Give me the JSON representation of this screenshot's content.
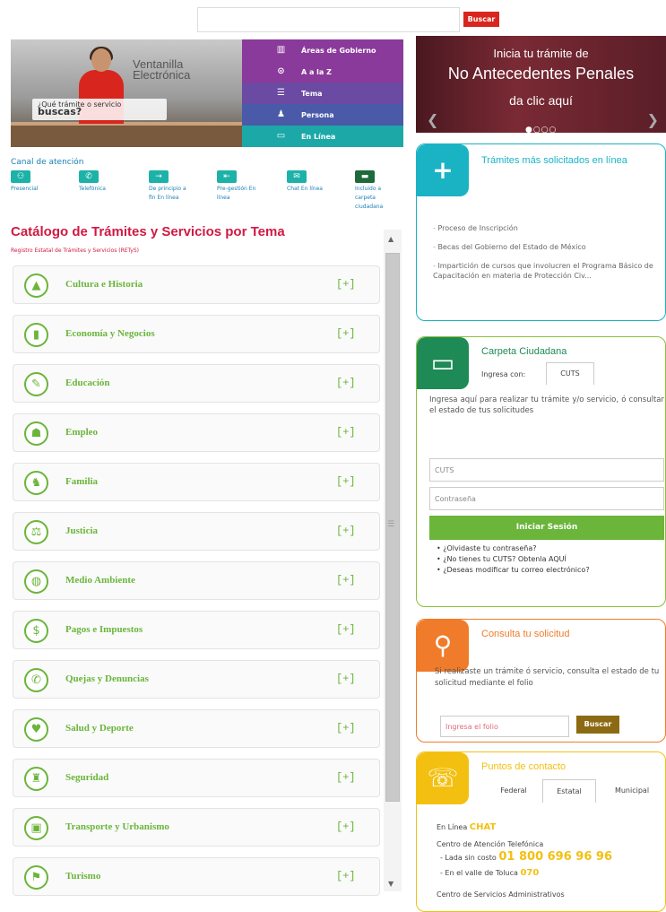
{
  "search": {
    "button": "Buscar",
    "placeholder": ""
  },
  "banner": {
    "brand_line1": "Ventanilla",
    "brand_line2": "Electrónica",
    "question_small": "¿Qué trámite o servicio",
    "question_big": "buscas?",
    "menu": [
      "Áreas de Gobierno",
      "A a la Z",
      "Tema",
      "Persona",
      "En Línea"
    ]
  },
  "canal": {
    "title": "Canal de atención",
    "items": [
      "Presencial",
      "Telefónica",
      "De principio a fin En línea",
      "Pre-gestión En línea",
      "Chat En línea",
      "Incluido a carpeta ciudadana"
    ]
  },
  "catalogo": {
    "title": "Catálogo de Trámites y Servicios por Tema",
    "subtitle": "Registro Estatal de Trámites y Servicios (RETyS)",
    "plus": "[+]",
    "items": [
      {
        "label": "Cultura e Historia",
        "icon": "pyramid-icon"
      },
      {
        "label": "Economía y Negocios",
        "icon": "chart-icon"
      },
      {
        "label": "Educación",
        "icon": "book-icon"
      },
      {
        "label": "Empleo",
        "icon": "worker-icon"
      },
      {
        "label": "Familia",
        "icon": "family-icon"
      },
      {
        "label": "Justicia",
        "icon": "scales-icon"
      },
      {
        "label": "Medio Ambiente",
        "icon": "globe-icon"
      },
      {
        "label": "Pagos e Impuestos",
        "icon": "money-icon"
      },
      {
        "label": "Quejas y Denuncias",
        "icon": "phone-icon"
      },
      {
        "label": "Salud y Deporte",
        "icon": "heart-icon"
      },
      {
        "label": "Seguridad",
        "icon": "police-icon"
      },
      {
        "label": "Transporte y Urbanismo",
        "icon": "bus-icon"
      },
      {
        "label": "Turismo",
        "icon": "signpost-icon"
      }
    ]
  },
  "carousel": {
    "line1": "Inicia tu trámite de",
    "line2": "No Antecedentes Penales",
    "line3": "da clic aquí"
  },
  "tramites": {
    "title": "Trámites más solicitados en línea",
    "items": [
      "Proceso de Inscripción",
      "Becas del Gobierno del Estado de México",
      "Impartición de cursos que involucren el Programa Básico de Capacitación en materia de Protección Civ..."
    ]
  },
  "carpeta": {
    "title": "Carpeta Ciudadana",
    "ingresa": "Ingresa con:",
    "tab": "CUTS",
    "desc": "Ingresa aquí para realizar tu trámite y/o servicio, ó consultar el estado de tus solicitudes",
    "cuts_placeholder": "CUTS",
    "pass_placeholder": "Contraseña",
    "login": "Iniciar Sesión",
    "links": [
      "¿Olvidaste tu contraseña?",
      "¿No tienes tu CUTS? Obtenla AQUÍ",
      "¿Deseas modificar tu correo electrónico?"
    ]
  },
  "consulta": {
    "title": "Consulta tu solicitud",
    "desc": "Si realizaste un trámite ó servicio, consulta el estado de tu solicitud mediante el folio",
    "placeholder": "Ingresa el folio",
    "button": "Buscar"
  },
  "contacto": {
    "title": "Puntos de contacto",
    "tabs": [
      "Federal",
      "Estatal",
      "Municipal"
    ],
    "en_linea": "En Línea",
    "chat": "CHAT",
    "centro": "Centro de Atención Telefónica",
    "lada_label": "- Lada sin costo",
    "lada_num": "01 800 696 96 96",
    "toluca_label": "- En el valle de Toluca",
    "toluca_num": "070",
    "centro_serv": "Centro de Servicios Administrativos"
  }
}
